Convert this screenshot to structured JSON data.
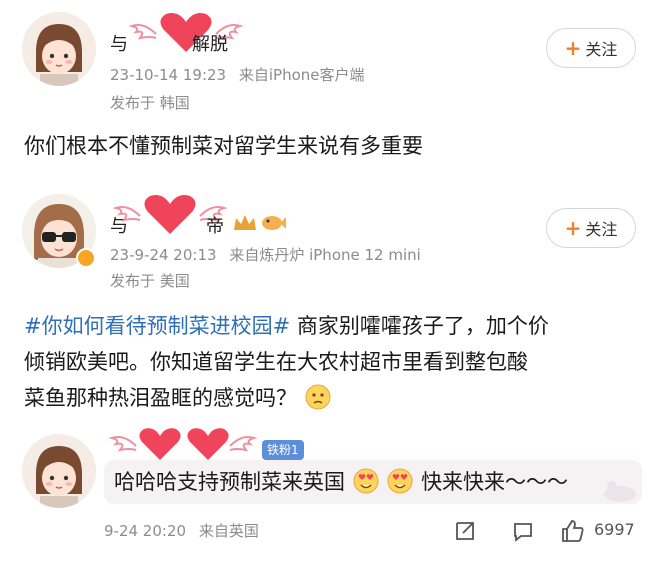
{
  "post1": {
    "username_visible": "与",
    "username_suffix": "解脱",
    "timestamp": "23-10-14 19:23",
    "source": "来自iPhone客户端",
    "location": "发布于 韩国",
    "follow_label": "关注",
    "follow_plus": "+",
    "text": "你们根本不懂预制菜对留学生来说有多重要"
  },
  "post2": {
    "username_visible": "与",
    "username_suffix": "帝",
    "timestamp": "23-9-24 20:13",
    "source": "来自炼丹炉 iPhone 12 mini",
    "location": "发布于 美国",
    "follow_label": "关注",
    "follow_plus": "+",
    "topic": "#你如何看待预制菜进校园#",
    "text_line1": " 商家别嚯嚯孩子了，加个价",
    "text_line2": "倾销欧美吧。你知道留学生在大农村超市里看到整包酸",
    "text_line3": "菜鱼那种热泪盈眶的感觉吗？"
  },
  "reply": {
    "fan_badge": "铁粉1",
    "text_part1": "哈哈哈支持预制菜来英国",
    "text_part2": "快来快来～～～",
    "timestamp": "9-24 20:20",
    "source": "来自英国",
    "like_count": "6997"
  },
  "icons": [
    "share-icon",
    "comment-icon",
    "like-icon",
    "heart-icon",
    "angel-wings-icon",
    "crown-icon"
  ],
  "colors": {
    "topic_blue": "#2f6fb5",
    "meta_gray": "#8c8c8c",
    "follow_orange": "#f0802a",
    "heart_red": "#f0445a",
    "badge_blue": "#5b8fd9"
  }
}
